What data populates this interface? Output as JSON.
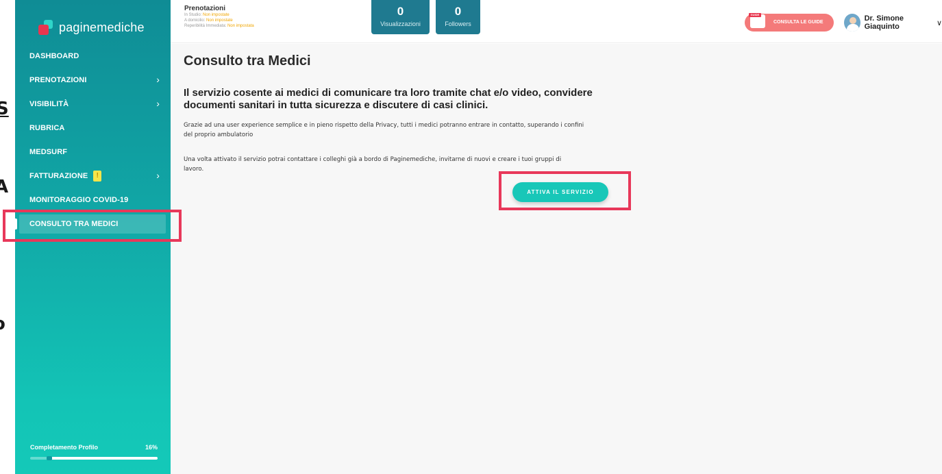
{
  "left_strip": {
    "glyphs": [
      "S",
      "A",
      "o"
    ]
  },
  "brand": {
    "name": "paginemediche"
  },
  "sidebar": {
    "items": [
      {
        "label": "DASHBOARD",
        "chevron": false
      },
      {
        "label": "PRENOTAZIONI",
        "chevron": true
      },
      {
        "label": "VISIBILITÀ",
        "chevron": true
      },
      {
        "label": "RUBRICA",
        "chevron": false
      },
      {
        "label": "MEDSURF",
        "chevron": false
      },
      {
        "label": "FATTURAZIONE",
        "chevron": true,
        "badge": "!"
      },
      {
        "label": "MONITORAGGIO COVID-19",
        "chevron": false
      },
      {
        "label": "CONSULTO TRA MEDICI",
        "chevron": false,
        "active": true
      }
    ],
    "chevron_glyph": "›",
    "profile": {
      "label": "Completamento Profilo",
      "percent_text": "16%",
      "percent": 16
    }
  },
  "topbar": {
    "prenotazioni": {
      "title": "Prenotazioni",
      "lines": [
        {
          "label": "In Studio:",
          "value": "Non impostate"
        },
        {
          "label": "A domicilio:",
          "value": "Non impostate"
        },
        {
          "label": "Reperibilità Immediata:",
          "value": "Non impostata"
        }
      ]
    },
    "stats": [
      {
        "value": "0",
        "label": "Visualizzazioni"
      },
      {
        "value": "0",
        "label": "Followers"
      }
    ],
    "guide_button": {
      "label": "CONSULTA LE GUIDE",
      "icon_tag": "GUIDE"
    },
    "user": {
      "name": "Dr. Simone Giaquinto",
      "chevron": "∨"
    }
  },
  "main": {
    "title": "Consulto tra Medici",
    "headline": "Il servizio cosente ai medici di comunicare tra loro tramite chat e/o video, convidere documenti sanitari in tutta sicurezza e discutere di casi clinici.",
    "paragraph1": "Grazie ad una user experience semplice e in pieno rispetto della Privacy, tutti i medici potranno entrare in contatto, superando i confini del proprio ambulatorio",
    "paragraph2": "Una volta attivato il servizio potrai contattare i colleghi già a bordo di Paginemediche, invitarne di nuovi e creare i tuoi gruppi di lavoro.",
    "cta_label": "ATTIVA IL SERVIZIO"
  },
  "colors": {
    "sidebar_top": "#0f8c95",
    "sidebar_bottom": "#14c9b8",
    "accent": "#18c7b8",
    "highlight": "#e8385a",
    "stat_bg": "#1f7a90",
    "guide_bg": "#f47a7a",
    "warning": "#f0a500"
  }
}
